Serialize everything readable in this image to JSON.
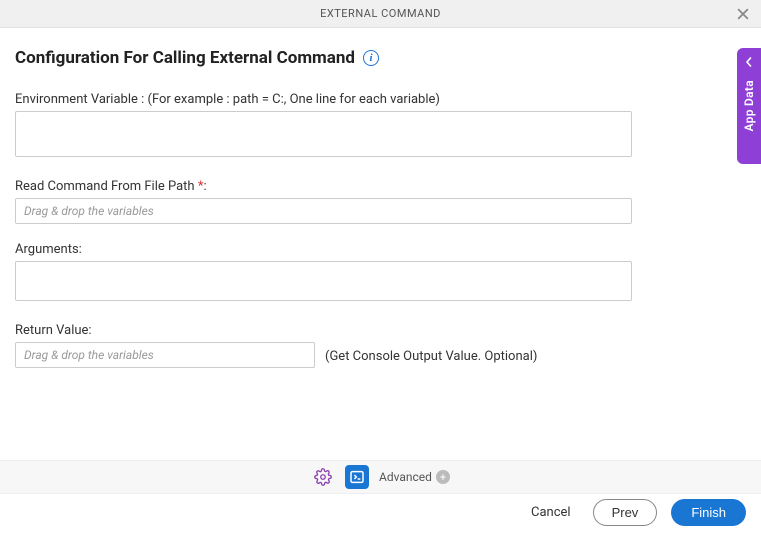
{
  "header": {
    "title": "EXTERNAL COMMAND"
  },
  "main": {
    "title": "Configuration For Calling External Command"
  },
  "fields": {
    "env": {
      "label": "Environment Variable : (For example : path = C:, One line for each variable)",
      "value": ""
    },
    "filepath": {
      "label": "Read Command From File Path ",
      "required_mark": "*",
      "colon": ":",
      "placeholder": "Drag & drop the variables",
      "value": ""
    },
    "arguments": {
      "label": "Arguments:",
      "value": ""
    },
    "returnvalue": {
      "label": "Return Value:",
      "placeholder": "Drag & drop the variables",
      "value": "",
      "hint": "(Get Console Output Value. Optional)"
    }
  },
  "toolbar": {
    "advanced_label": "Advanced"
  },
  "footer": {
    "cancel": "Cancel",
    "prev": "Prev",
    "finish": "Finish"
  },
  "sidetab": {
    "label": "App Data"
  }
}
